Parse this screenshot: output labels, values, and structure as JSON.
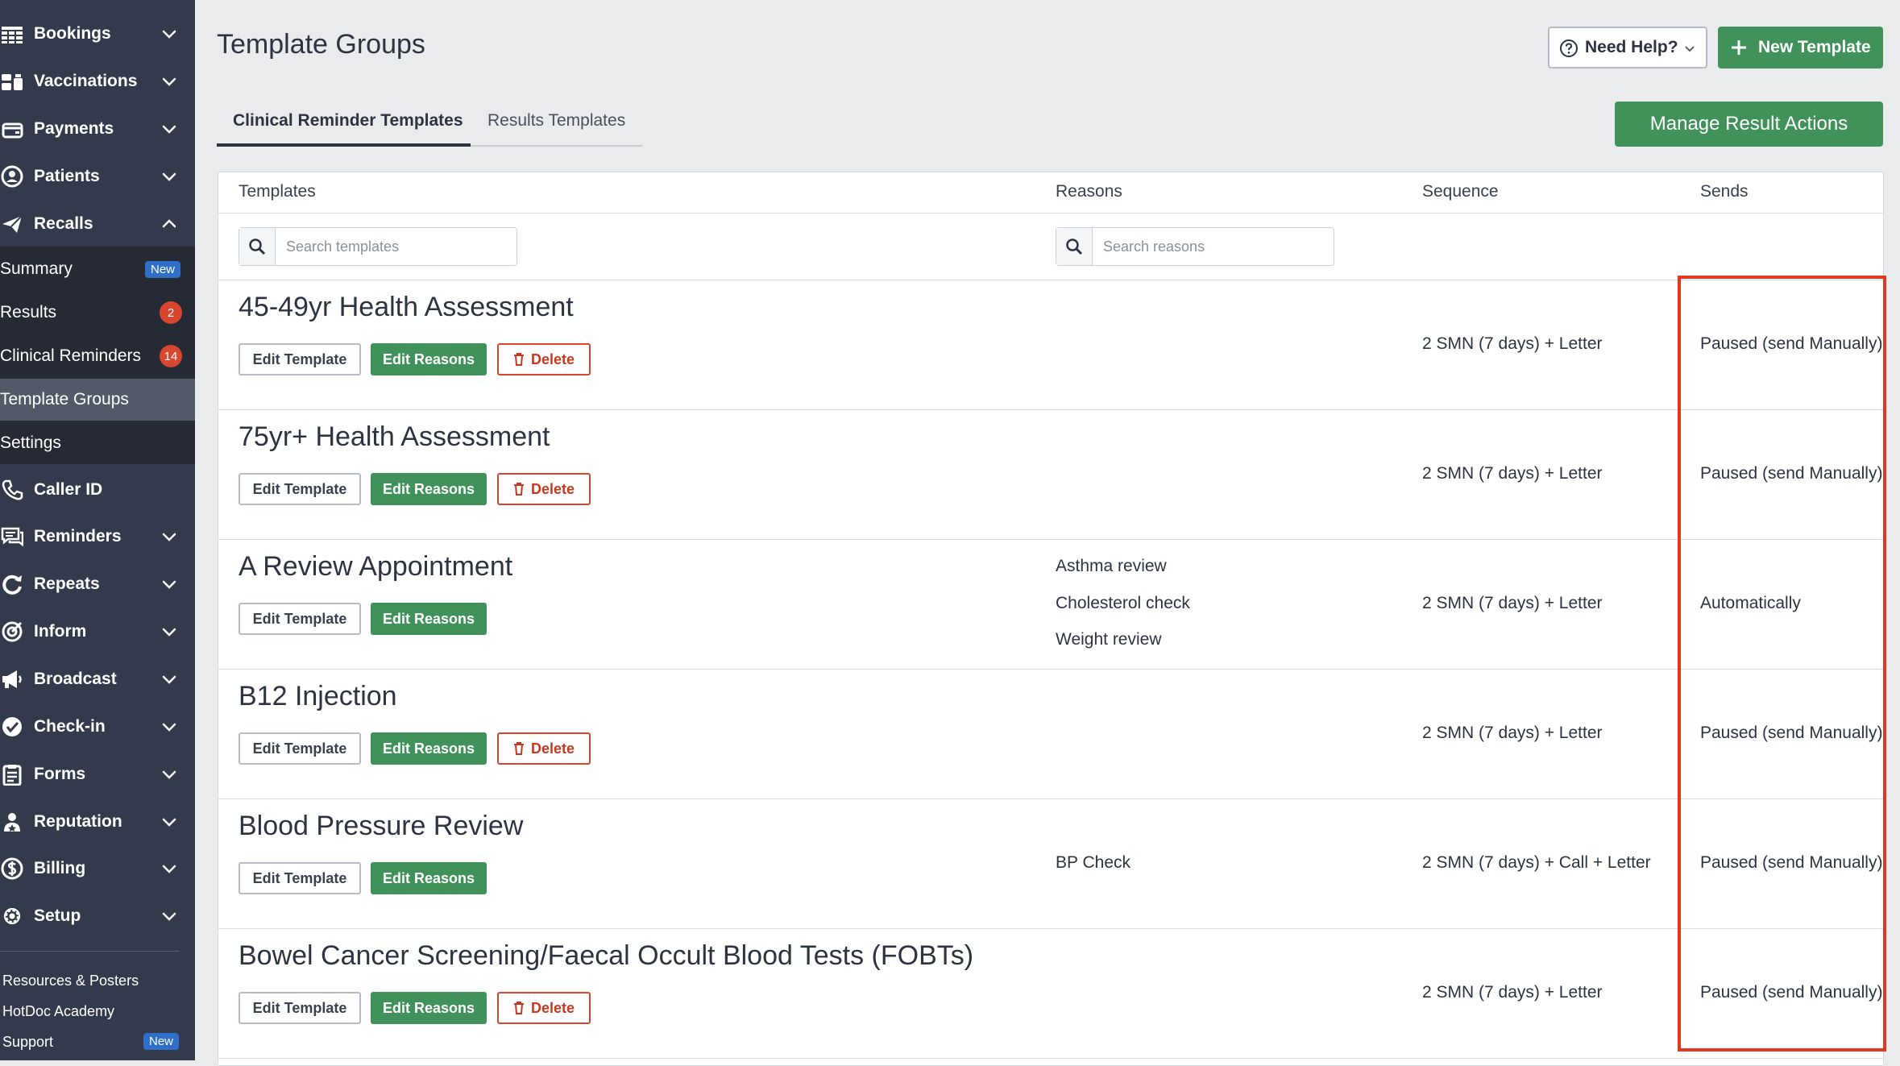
{
  "sidebar": {
    "items": [
      {
        "label": "Bookings",
        "icon": "table-icon"
      },
      {
        "label": "Vaccinations",
        "icon": "vaccination-icon"
      },
      {
        "label": "Payments",
        "icon": "wallet-icon"
      },
      {
        "label": "Patients",
        "icon": "user-icon"
      },
      {
        "label": "Recalls",
        "icon": "paper-plane-icon"
      },
      {
        "label": "Caller ID",
        "icon": "phone-icon"
      },
      {
        "label": "Reminders",
        "icon": "chat-icon"
      },
      {
        "label": "Repeats",
        "icon": "refresh-icon"
      },
      {
        "label": "Inform",
        "icon": "target-icon"
      },
      {
        "label": "Broadcast",
        "icon": "megaphone-icon"
      },
      {
        "label": "Check-in",
        "icon": "check-circle-icon"
      },
      {
        "label": "Forms",
        "icon": "clipboard-icon"
      },
      {
        "label": "Reputation",
        "icon": "star-user-icon"
      },
      {
        "label": "Billing",
        "icon": "dollar-icon"
      },
      {
        "label": "Setup",
        "icon": "gear-icon"
      }
    ],
    "recalls_sub": [
      {
        "label": "Summary",
        "badge": "New"
      },
      {
        "label": "Results",
        "badge": "2"
      },
      {
        "label": "Clinical Reminders",
        "badge": "14"
      },
      {
        "label": "Template Groups",
        "badge": ""
      },
      {
        "label": "Settings",
        "badge": ""
      }
    ],
    "footer": [
      {
        "label": "Resources & Posters",
        "badge": ""
      },
      {
        "label": "HotDoc Academy",
        "badge": ""
      },
      {
        "label": "Support",
        "badge": "New"
      }
    ]
  },
  "header": {
    "title": "Template Groups",
    "help_label": "Need Help?",
    "new_template_label": "New Template"
  },
  "tabs": [
    {
      "label": "Clinical Reminder Templates",
      "active": true
    },
    {
      "label": "Results Templates",
      "active": false
    }
  ],
  "manage_label": "Manage Result Actions",
  "table": {
    "columns": [
      "Templates",
      "Reasons",
      "Sequence",
      "Sends"
    ],
    "search_templates_placeholder": "Search templates",
    "search_reasons_placeholder": "Search reasons",
    "button_labels": {
      "edit_template": "Edit Template",
      "edit_reasons": "Edit Reasons",
      "delete": "Delete"
    },
    "rows": [
      {
        "name": "45-49yr Health Assessment",
        "reasons": [],
        "sequence": "2 SMN (7 days) + Letter",
        "sends": "Paused (send Manually)",
        "deletable": true
      },
      {
        "name": "75yr+ Health Assessment",
        "reasons": [],
        "sequence": "2 SMN (7 days) + Letter",
        "sends": "Paused (send Manually)",
        "deletable": true
      },
      {
        "name": "A Review Appointment",
        "reasons": [
          "Asthma review",
          "Cholesterol check",
          "Weight review"
        ],
        "sequence": "2 SMN (7 days) + Letter",
        "sends": "Automatically",
        "deletable": false
      },
      {
        "name": "B12 Injection",
        "reasons": [],
        "sequence": "2 SMN (7 days) + Letter",
        "sends": "Paused (send Manually)",
        "deletable": true
      },
      {
        "name": "Blood Pressure Review",
        "reasons": [
          "BP Check"
        ],
        "sequence": "2 SMN (7 days) + Call + Letter",
        "sends": "Paused (send Manually)",
        "deletable": false
      },
      {
        "name": "Bowel Cancer Screening/Faecal Occult Blood Tests (FOBTs)",
        "reasons": [],
        "sequence": "2 SMN (7 days) + Letter",
        "sends": "Paused (send Manually)",
        "deletable": true
      }
    ]
  },
  "colors": {
    "sidebar_bg": "#333a4b",
    "sidebar_sub_bg": "#252a35",
    "primary_green": "#41925a",
    "danger_red": "#d9452e",
    "badge_blue": "#2f6fc8",
    "highlight_red": "#e2381f"
  }
}
